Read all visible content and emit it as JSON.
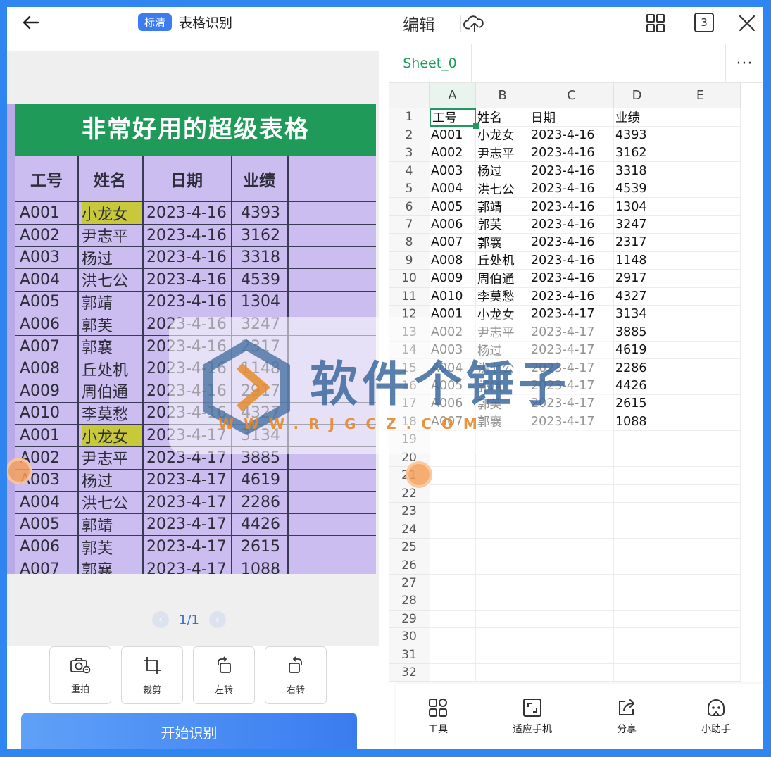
{
  "left": {
    "badge": "标清",
    "title": "表格识别",
    "photo_title": "非常好用的超级表格",
    "photo_headers": [
      "工号",
      "姓名",
      "日期",
      "业绩"
    ],
    "photo_rows": [
      [
        "A001",
        "小龙女",
        "2023-4-16",
        "4393"
      ],
      [
        "A002",
        "尹志平",
        "2023-4-16",
        "3162"
      ],
      [
        "A003",
        "杨过",
        "2023-4-16",
        "3318"
      ],
      [
        "A004",
        "洪七公",
        "2023-4-16",
        "4539"
      ],
      [
        "A005",
        "郭靖",
        "2023-4-16",
        "1304"
      ],
      [
        "A006",
        "郭芙",
        "2023-4-16",
        "3247"
      ],
      [
        "A007",
        "郭襄",
        "2023-4-16",
        "2317"
      ],
      [
        "A008",
        "丘处机",
        "2023-4-16",
        "1148"
      ],
      [
        "A009",
        "周伯通",
        "2023-4-16",
        "2917"
      ],
      [
        "A010",
        "李莫愁",
        "2023-4-16",
        "4327"
      ],
      [
        "A001",
        "小龙女",
        "2023-4-17",
        "3134"
      ],
      [
        "A002",
        "尹志平",
        "2023-4-17",
        "3885"
      ],
      [
        "A003",
        "杨过",
        "2023-4-17",
        "4619"
      ],
      [
        "A004",
        "洪七公",
        "2023-4-17",
        "2286"
      ],
      [
        "A005",
        "郭靖",
        "2023-4-17",
        "4426"
      ],
      [
        "A006",
        "郭芙",
        "2023-4-17",
        "2615"
      ],
      [
        "A007",
        "郭襄",
        "2023-4-17",
        "1088"
      ]
    ],
    "pager": "1/1",
    "tools": [
      {
        "label": "重拍",
        "icon": "retake-camera-icon"
      },
      {
        "label": "裁剪",
        "icon": "crop-icon"
      },
      {
        "label": "左转",
        "icon": "rotate-left-icon"
      },
      {
        "label": "右转",
        "icon": "rotate-right-icon"
      }
    ],
    "start_button": "开始识别"
  },
  "right": {
    "edit_label": "编辑",
    "tab_count": "3",
    "sheet_tab": "Sheet_0",
    "more": "···",
    "columns": [
      "A",
      "B",
      "C",
      "D",
      "E"
    ],
    "row_numbers": [
      "1",
      "2",
      "3",
      "4",
      "5",
      "6",
      "7",
      "8",
      "9",
      "10",
      "11",
      "12",
      "13",
      "14",
      "15",
      "16",
      "17",
      "18",
      "19",
      "20",
      "21",
      "22",
      "23",
      "24",
      "25",
      "26",
      "27",
      "28",
      "29",
      "30",
      "31",
      "32"
    ],
    "rows": [
      [
        "工号",
        "姓名",
        "日期",
        "业绩"
      ],
      [
        "A001",
        "小龙女",
        "2023-4-16",
        "4393"
      ],
      [
        "A002",
        "尹志平",
        "2023-4-16",
        "3162"
      ],
      [
        "A003",
        "杨过",
        "2023-4-16",
        "3318"
      ],
      [
        "A004",
        "洪七公",
        "2023-4-16",
        "4539"
      ],
      [
        "A005",
        "郭靖",
        "2023-4-16",
        "1304"
      ],
      [
        "A006",
        "郭芙",
        "2023-4-16",
        "3247"
      ],
      [
        "A007",
        "郭襄",
        "2023-4-16",
        "2317"
      ],
      [
        "A008",
        "丘处机",
        "2023-4-16",
        "1148"
      ],
      [
        "A009",
        "周伯通",
        "2023-4-16",
        "2917"
      ],
      [
        "A010",
        "李莫愁",
        "2023-4-16",
        "4327"
      ],
      [
        "A001",
        "小龙女",
        "2023-4-17",
        "3134"
      ],
      [
        "A002",
        "尹志平",
        "2023-4-17",
        "3885"
      ],
      [
        "A003",
        "杨过",
        "2023-4-17",
        "4619"
      ],
      [
        "A004",
        "洪七公",
        "2023-4-17",
        "2286"
      ],
      [
        "A005",
        "郭靖",
        "2023-4-17",
        "4426"
      ],
      [
        "A006",
        "郭芙",
        "2023-4-17",
        "2615"
      ],
      [
        "A007",
        "郭襄",
        "2023-4-17",
        "1088"
      ]
    ],
    "bottom_tools": [
      {
        "label": "工具",
        "icon": "tools-grid-icon"
      },
      {
        "label": "适应手机",
        "icon": "fit-phone-icon"
      },
      {
        "label": "分享",
        "icon": "share-icon"
      },
      {
        "label": "小助手",
        "icon": "assistant-icon"
      }
    ]
  },
  "watermark": {
    "text": "软件个锤子",
    "sub": "WWW.RJGCZ.COM"
  },
  "colors": {
    "accent": "#3b7cf0",
    "sheet_green": "#1e9a5e",
    "frame_blue": "#2f86f0"
  }
}
